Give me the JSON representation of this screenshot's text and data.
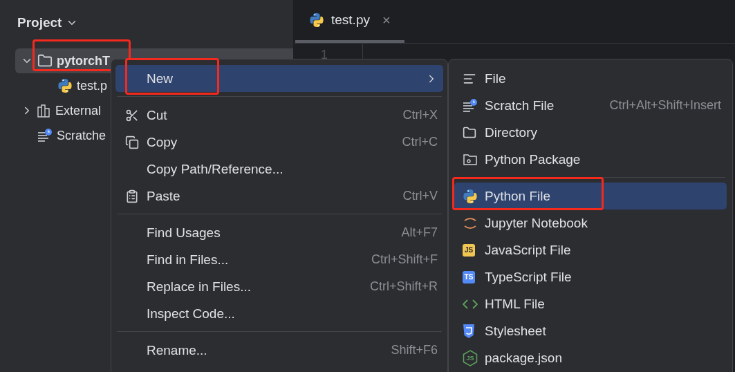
{
  "project_panel": {
    "title": "Project",
    "tree": [
      {
        "name": "pytorchT",
        "kind": "folder",
        "expanded": true,
        "selected": true,
        "highlighted": true,
        "children": [
          {
            "name": "test.p",
            "kind": "python",
            "selected": false,
            "highlighted": false
          }
        ]
      },
      {
        "name": "External",
        "kind": "library",
        "expanded": false,
        "selected": false,
        "highlighted": false
      },
      {
        "name": "Scratche",
        "kind": "scratch",
        "selected": false,
        "highlighted": false
      }
    ]
  },
  "editor": {
    "tabs": [
      {
        "label": "test.py",
        "selected": true,
        "close": "×"
      }
    ],
    "line_numbers": [
      "1"
    ]
  },
  "context_menu": {
    "items": [
      {
        "kind": "plain",
        "label": "New",
        "submenu": true,
        "selected": true,
        "highlighted": true
      },
      {
        "kind": "separator"
      },
      {
        "kind": "cut",
        "label": "Cut",
        "shortcut": "Ctrl+X",
        "selected": false,
        "highlighted": false
      },
      {
        "kind": "copy",
        "label": "Copy",
        "shortcut": "Ctrl+C",
        "selected": false,
        "highlighted": false
      },
      {
        "kind": "plain",
        "label": "Copy Path/Reference...",
        "selected": false,
        "highlighted": false
      },
      {
        "kind": "paste",
        "label": "Paste",
        "shortcut": "Ctrl+V",
        "selected": false,
        "highlighted": false
      },
      {
        "kind": "separator"
      },
      {
        "kind": "plain",
        "label": "Find Usages",
        "shortcut": "Alt+F7",
        "selected": false,
        "highlighted": false
      },
      {
        "kind": "plain",
        "label": "Find in Files...",
        "shortcut": "Ctrl+Shift+F",
        "selected": false,
        "highlighted": false
      },
      {
        "kind": "plain",
        "label": "Replace in Files...",
        "shortcut": "Ctrl+Shift+R",
        "selected": false,
        "highlighted": false
      },
      {
        "kind": "plain",
        "label": "Inspect Code...",
        "selected": false,
        "highlighted": false
      },
      {
        "kind": "separator"
      },
      {
        "kind": "plain",
        "label": "Rename...",
        "shortcut": "Shift+F6",
        "selected": false,
        "highlighted": false
      }
    ]
  },
  "new_submenu": {
    "items": [
      {
        "kind": "file",
        "label": "File",
        "selected": false,
        "highlighted": false
      },
      {
        "kind": "scratch",
        "label": "Scratch File",
        "shortcut": "Ctrl+Alt+Shift+Insert",
        "selected": false,
        "highlighted": false
      },
      {
        "kind": "directory",
        "label": "Directory",
        "selected": false,
        "highlighted": false
      },
      {
        "kind": "package",
        "label": "Python Package",
        "selected": false,
        "highlighted": false
      },
      {
        "kind": "separator"
      },
      {
        "kind": "python",
        "label": "Python File",
        "selected": true,
        "highlighted": true
      },
      {
        "kind": "jupyter",
        "label": "Jupyter Notebook",
        "selected": false,
        "highlighted": false
      },
      {
        "kind": "javascript",
        "badge": "JS",
        "label": "JavaScript File",
        "selected": false,
        "highlighted": false
      },
      {
        "kind": "typescript",
        "badge": "TS",
        "label": "TypeScript File",
        "selected": false,
        "highlighted": false
      },
      {
        "kind": "html",
        "label": "HTML File",
        "selected": false,
        "highlighted": false
      },
      {
        "kind": "css",
        "label": "Stylesheet",
        "selected": false,
        "highlighted": false
      },
      {
        "kind": "node",
        "badge": "JS",
        "label": "package.json",
        "selected": false,
        "highlighted": false
      }
    ]
  }
}
